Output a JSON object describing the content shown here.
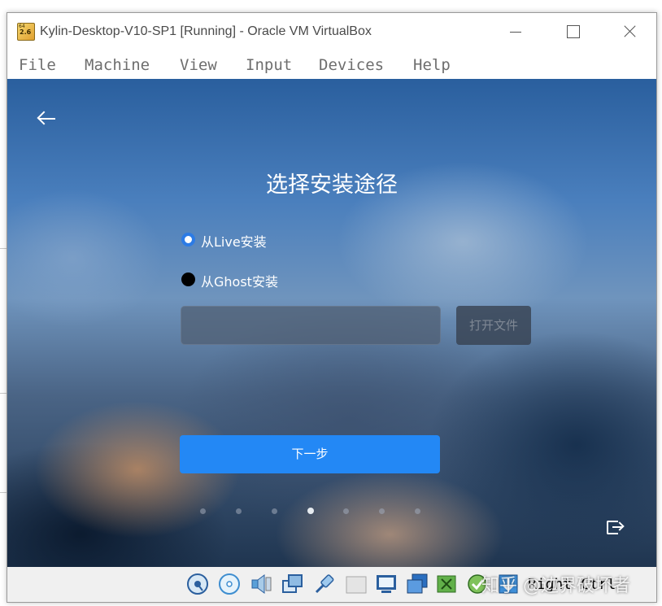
{
  "window": {
    "title": "Kylin-Desktop-V10-SP1 [Running] - Oracle VM VirtualBox",
    "icon_badge": "2.6",
    "icon_corner": "64"
  },
  "menu": {
    "items": [
      "File",
      "Machine",
      "View",
      "Input",
      "Devices",
      "Help"
    ]
  },
  "installer": {
    "title": "选择安装途径",
    "options": [
      {
        "label": "从Live安装",
        "selected": true
      },
      {
        "label": "从Ghost安装",
        "selected": false
      }
    ],
    "path_input_value": "",
    "open_file_label": "打开文件",
    "next_label": "下一步",
    "step_total": 7,
    "step_current": 4
  },
  "status": {
    "host_key": "Right Ctrl",
    "watermark": "知乎 @边界破坏者",
    "icons": [
      "hard-disk-icon",
      "optical-drive-icon",
      "audio-icon",
      "network-icon",
      "usb-icon",
      "shared-folder-icon",
      "display-icon",
      "screen-capture-icon",
      "video-capture-icon",
      "cpu-icon",
      "mouse-integration-icon"
    ]
  },
  "colors": {
    "accent": "#2388f5",
    "radio_selected": "#2c7be5"
  }
}
